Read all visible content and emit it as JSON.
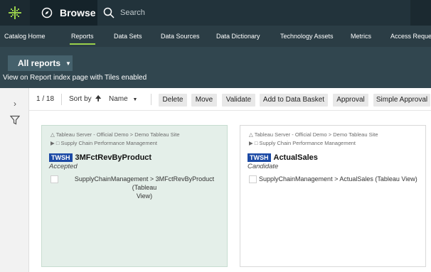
{
  "topbar": {
    "browse_label": "Browse",
    "search_placeholder": "Search",
    "logo_icon": "grid-logo-icon",
    "browse_icon": "compass-icon",
    "search_icon": "search-icon"
  },
  "nav": {
    "tabs": [
      {
        "label": "Catalog Home"
      },
      {
        "label": "Reports",
        "active": true
      },
      {
        "label": "Data Sets"
      },
      {
        "label": "Data Sources"
      },
      {
        "label": "Data Dictionary"
      },
      {
        "label": "Technology Assets"
      },
      {
        "label": "Metrics"
      },
      {
        "label": "Access Reques"
      }
    ]
  },
  "header": {
    "dropdown_label": "All reports",
    "subtitle": "View on Report index page with Tiles enabled"
  },
  "toolbar": {
    "page_count": "1 / 18",
    "sort_label": "Sort by",
    "sort_direction_icon": "arrow-up-icon",
    "sort_field": "Name",
    "buttons": [
      "Delete",
      "Move",
      "Validate",
      "Add to Data Basket",
      "Approval",
      "Simple Approval"
    ]
  },
  "cards": [
    {
      "crumb_line1": "Tableau Server - Official Demo > Demo Tableau Site",
      "crumb_line2": "Supply Chain Performance Management",
      "badge": "TWSH",
      "title": "3MFctRevByProduct",
      "status": "Accepted",
      "path_line1": "SupplyChainManagement > 3MFctRevByProduct (Tableau",
      "path_line2": "View)",
      "selected": true
    },
    {
      "crumb_line1": "Tableau Server - Official Demo > Demo Tableau Site",
      "crumb_line2": "Supply Chain Performance Management",
      "badge": "TWSH",
      "title": "ActualSales",
      "status": "Candidate",
      "path_line1": "SupplyChainManagement > ActualSales (Tableau View)",
      "path_line2": "",
      "selected": false
    }
  ],
  "colors": {
    "topbar": "#22333b",
    "nav": "#2b3d45",
    "header": "#31464f",
    "accent": "#9ad14b",
    "badge": "#1c4aa5",
    "selected_card": "#e4efe9"
  }
}
